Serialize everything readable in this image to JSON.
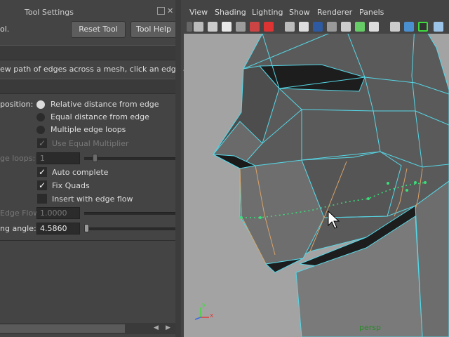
{
  "tool_settings": {
    "title": "Tool Settings",
    "tool_name_fragment": "ol.",
    "reset_button": "Reset Tool",
    "help_button": "Tool Help",
    "help_text": "ew path of edges across a mesh, click an edge and d"
  },
  "options": {
    "position_label": "position:",
    "radio_relative": "Relative distance from edge",
    "radio_equal": "Equal distance from edge",
    "radio_multiple": "Multiple edge loops",
    "use_equal_multiplier": "Use Equal Multiplier",
    "edge_loops_label": "ge loops:",
    "edge_loops_value": "1",
    "auto_complete": "Auto complete",
    "fix_quads": "Fix Quads",
    "insert_edge_flow": "Insert with edge flow",
    "edge_flow_label": "Edge Flow",
    "edge_flow_value": "1.0000",
    "angle_label": "ng angle:",
    "angle_value": "4.5860"
  },
  "viewport": {
    "menus": [
      "View",
      "Shading",
      "Lighting",
      "Show",
      "Renderer",
      "Panels"
    ],
    "camera_label": "persp",
    "axis_y": "y",
    "axis_x": "x"
  },
  "colors": {
    "wire": "#56d7e6",
    "selected_edge": "#d9a36a",
    "insert_point": "#39e07a"
  }
}
